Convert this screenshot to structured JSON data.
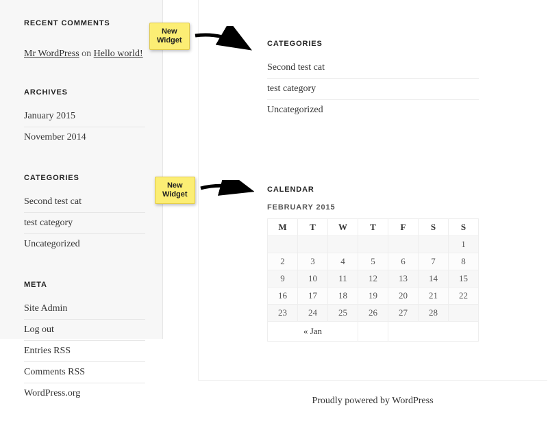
{
  "sidebar": {
    "recent_comments": {
      "title": "RECENT COMMENTS",
      "item": {
        "author": "Mr WordPress",
        "sep": "on",
        "post": "Hello world!"
      }
    },
    "archives": {
      "title": "ARCHIVES",
      "items": [
        "January 2015",
        "November 2014"
      ]
    },
    "categories": {
      "title": "CATEGORIES",
      "items": [
        "Second test cat",
        "test category",
        "Uncategorized"
      ]
    },
    "meta": {
      "title": "META",
      "items": [
        "Site Admin",
        "Log out",
        "Entries RSS",
        "Comments RSS",
        "WordPress.org"
      ]
    }
  },
  "main": {
    "categories": {
      "title": "CATEGORIES",
      "items": [
        "Second test cat",
        "test category",
        "Uncategorized"
      ]
    },
    "calendar": {
      "title": "CALENDAR",
      "caption": "FEBRUARY 2015",
      "dow": [
        "M",
        "T",
        "W",
        "T",
        "F",
        "S",
        "S"
      ],
      "weeks": [
        [
          "",
          "",
          "",
          "",
          "",
          "",
          "1"
        ],
        [
          "2",
          "3",
          "4",
          "5",
          "6",
          "7",
          "8"
        ],
        [
          "9",
          "10",
          "11",
          "12",
          "13",
          "14",
          "15"
        ],
        [
          "16",
          "17",
          "18",
          "19",
          "20",
          "21",
          "22"
        ],
        [
          "23",
          "24",
          "25",
          "26",
          "27",
          "28",
          ""
        ]
      ],
      "prev": "« Jan"
    }
  },
  "annotations": {
    "note1": "New\nWidget",
    "note2": "New\nWidget"
  },
  "footer": {
    "text": "Proudly powered by WordPress"
  }
}
